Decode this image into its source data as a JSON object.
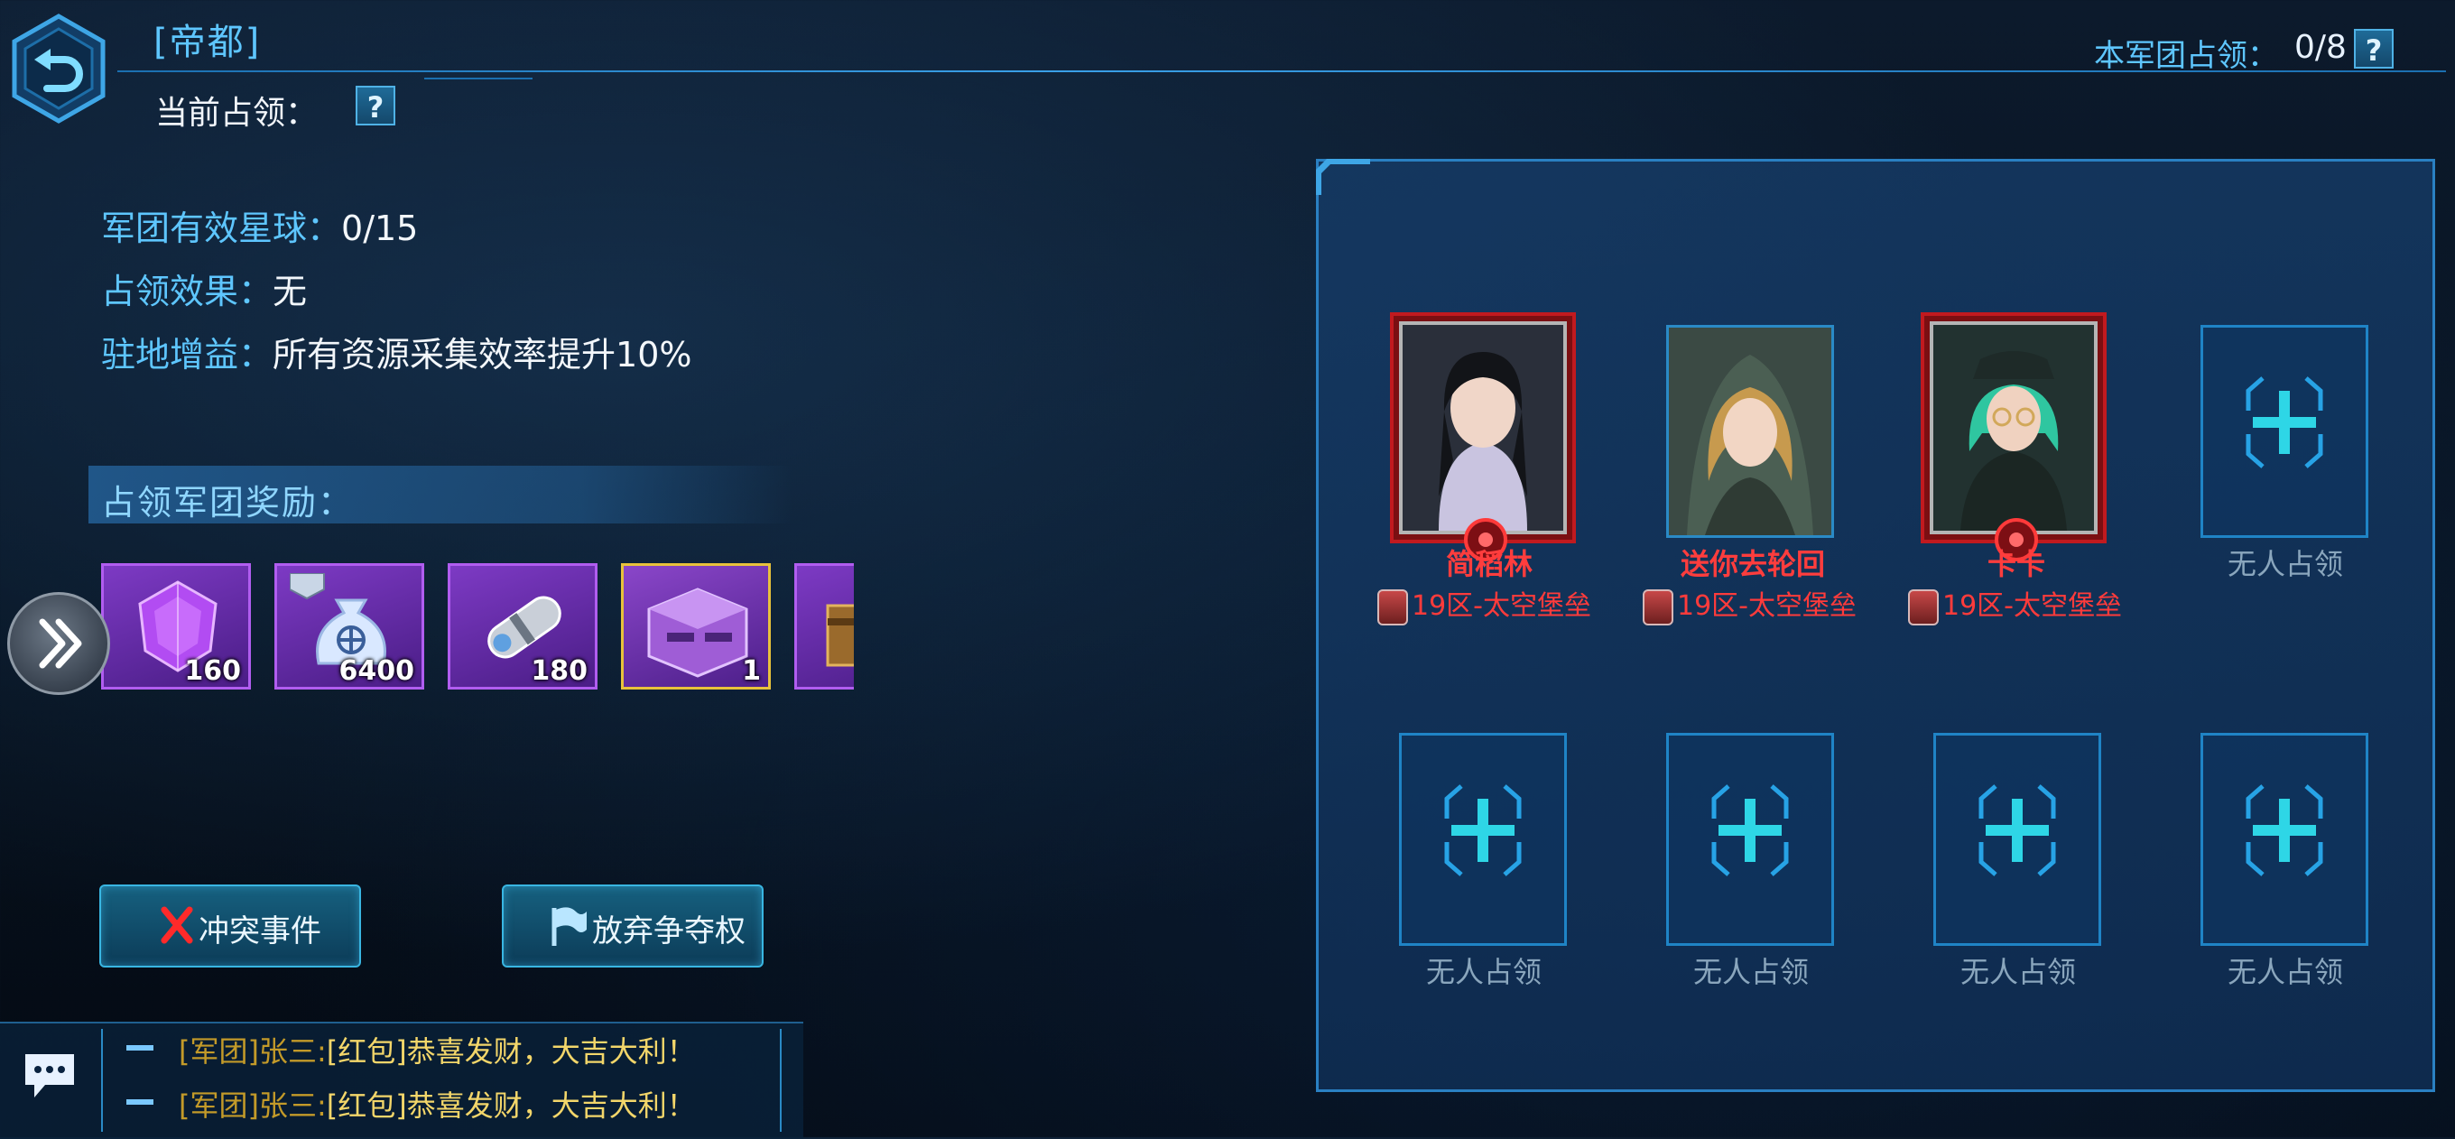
{
  "header": {
    "title": "[帝都]",
    "current_occupy_label": "当前占领：",
    "army_occupy_label": "本军团占领：",
    "army_occupy_value": "0/8",
    "help_glyph": "?"
  },
  "info": {
    "valid_planets_label": "军团有效星球：",
    "valid_planets_value": "0/15",
    "occupy_effect_label": "占领效果：",
    "occupy_effect_value": "无",
    "garrison_bonus_label": "驻地增益：",
    "garrison_bonus_value": "所有资源采集效率提升10%"
  },
  "rewards": {
    "header": "占领军团奖励：",
    "items": [
      {
        "icon": "purple-crystal-icon",
        "count": "160"
      },
      {
        "icon": "money-bag-icon",
        "count": "6400"
      },
      {
        "icon": "capsule-icon",
        "count": "180"
      },
      {
        "icon": "supply-crate-icon",
        "count": "1"
      },
      {
        "icon": "chest-icon",
        "count": ""
      }
    ]
  },
  "actions": {
    "conflict": "冲突事件",
    "abandon": "放弃争夺权"
  },
  "chat": {
    "lines": [
      {
        "tag": "[军团]张三:",
        "msg": "[红包]恭喜发财，大吉大利！"
      },
      {
        "tag": "[军团]张三:",
        "msg": "[红包]恭喜发财，大吉大利！"
      }
    ]
  },
  "slots": [
    {
      "name": "简稻林",
      "zone": "19区-太空堡垒",
      "occupied": true
    },
    {
      "name": "送你去轮回",
      "zone": "19区-太空堡垒",
      "occupied": true
    },
    {
      "name": "卡卡",
      "zone": "19区-太空堡垒",
      "occupied": true
    },
    {
      "name": "无人占领",
      "occupied": false
    },
    {
      "name": "无人占领",
      "occupied": false
    },
    {
      "name": "无人占领",
      "occupied": false
    },
    {
      "name": "无人占领",
      "occupied": false
    },
    {
      "name": "无人占领",
      "occupied": false
    }
  ],
  "colors": {
    "accent_blue": "#5ec6ff",
    "enemy_red": "#ff3d3d",
    "chat_gold": "#f3d66a"
  }
}
